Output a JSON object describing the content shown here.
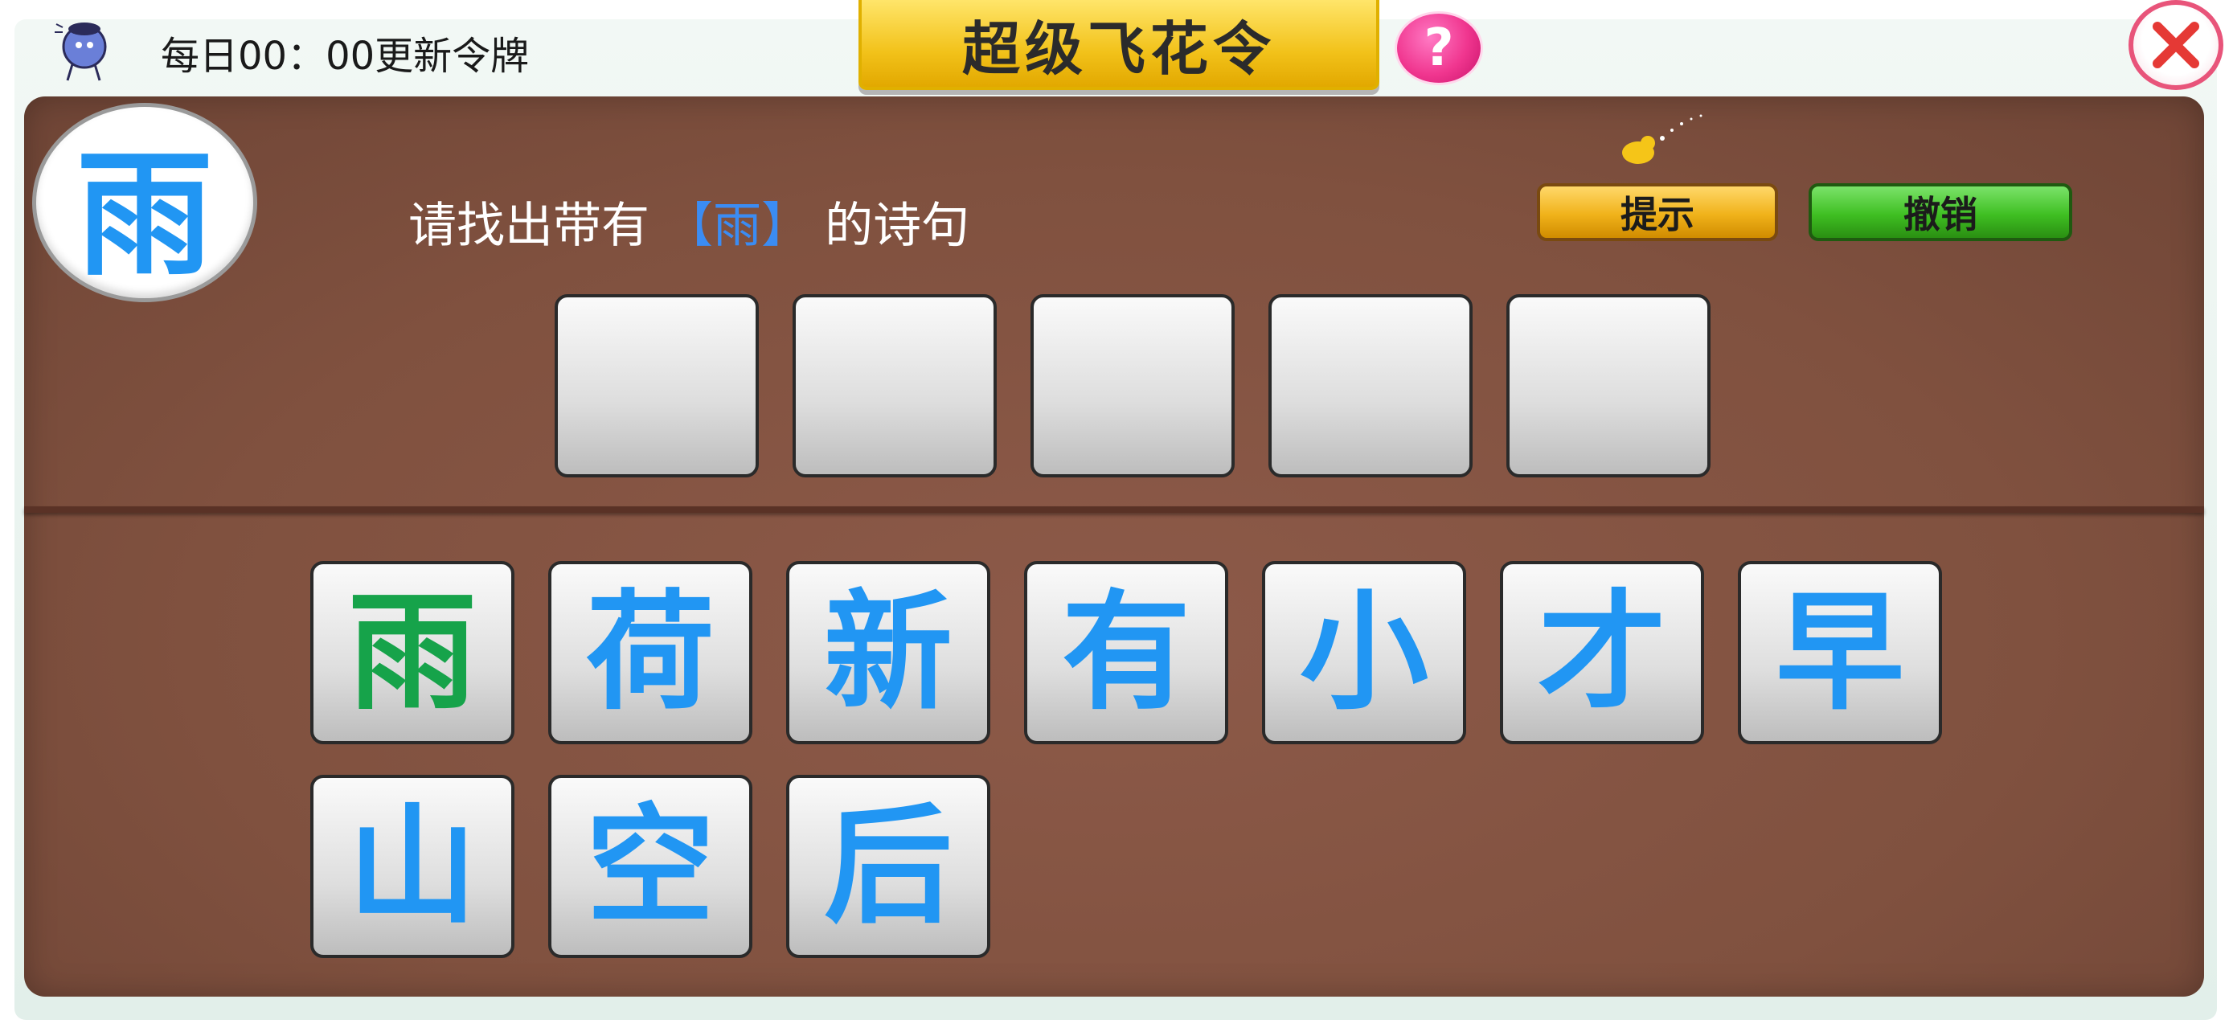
{
  "header": {
    "refresh_notice": "每日00：00更新令牌",
    "title": "超级飞花令",
    "help_label": "?",
    "close_icon": "close-x-icon"
  },
  "puzzle": {
    "keyword": "雨",
    "prompt_before": "请找出带有",
    "prompt_keyword": "【雨】",
    "prompt_after": "的诗句",
    "answer_slot_count": 5
  },
  "buttons": {
    "hint": "提示",
    "undo": "撤销"
  },
  "tiles": {
    "row1": [
      "雨",
      "荷",
      "新",
      "有",
      "小",
      "才",
      "早"
    ],
    "row2": [
      "山",
      "空",
      "后"
    ]
  },
  "colors": {
    "tile_text": "#2196f3",
    "tile_used_text": "#16a34a",
    "board": "#80513f",
    "title_plate": "#f2c21a",
    "hint_button": "#f0b21a",
    "undo_button": "#3fbf22"
  }
}
